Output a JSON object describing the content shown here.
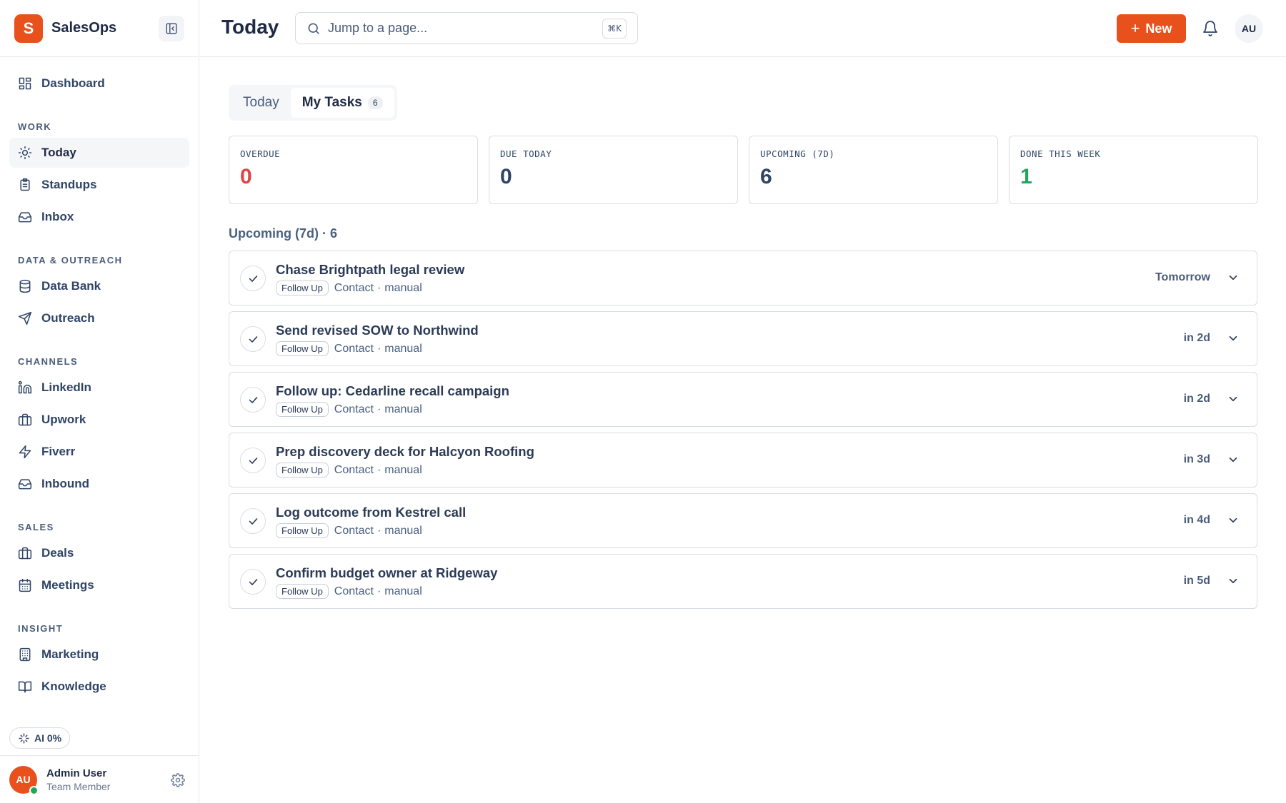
{
  "brand": {
    "name": "SalesOps",
    "logo_letter": "S",
    "color": "#e8501c"
  },
  "sidebar": {
    "top_items": [
      {
        "label": "Dashboard",
        "icon": "grid-icon"
      }
    ],
    "sections": [
      {
        "title": "WORK",
        "items": [
          {
            "label": "Today",
            "icon": "sun-icon",
            "active": true
          },
          {
            "label": "Standups",
            "icon": "clipboard-icon"
          },
          {
            "label": "Inbox",
            "icon": "inbox-icon"
          }
        ]
      },
      {
        "title": "DATA & OUTREACH",
        "items": [
          {
            "label": "Data Bank",
            "icon": "database-icon"
          },
          {
            "label": "Outreach",
            "icon": "send-icon"
          }
        ]
      },
      {
        "title": "CHANNELS",
        "items": [
          {
            "label": "LinkedIn",
            "icon": "linkedin-icon"
          },
          {
            "label": "Upwork",
            "icon": "briefcase-icon"
          },
          {
            "label": "Fiverr",
            "icon": "bolt-icon"
          },
          {
            "label": "Inbound",
            "icon": "inbox-icon"
          }
        ]
      },
      {
        "title": "SALES",
        "items": [
          {
            "label": "Deals",
            "icon": "briefcase-icon"
          },
          {
            "label": "Meetings",
            "icon": "calendar-icon"
          }
        ]
      },
      {
        "title": "INSIGHT",
        "items": [
          {
            "label": "Marketing",
            "icon": "building-icon"
          },
          {
            "label": "Knowledge",
            "icon": "book-icon"
          }
        ]
      }
    ],
    "ai_badge": "AI 0%",
    "user": {
      "initials": "AU",
      "name": "Admin User",
      "role": "Team Member"
    }
  },
  "header": {
    "title": "Today",
    "search_placeholder": "Jump to a page...",
    "search_shortcut": "⌘K",
    "new_label": "New",
    "avatar_initials": "AU"
  },
  "tabs": [
    {
      "label": "Today",
      "active": false
    },
    {
      "label": "My Tasks",
      "active": true,
      "count": "6"
    }
  ],
  "stats": [
    {
      "label": "OVERDUE",
      "value": "0",
      "color": "#e04444"
    },
    {
      "label": "DUE TODAY",
      "value": "0",
      "color": "#2f4466"
    },
    {
      "label": "UPCOMING (7D)",
      "value": "6",
      "color": "#2f4466"
    },
    {
      "label": "DONE THIS WEEK",
      "value": "1",
      "color": "#22a55b"
    }
  ],
  "list_heading": "Upcoming (7d) · 6",
  "tasks": [
    {
      "title": "Chase Brightpath legal review",
      "tag": "Follow Up",
      "entity": "Contact",
      "source": "manual",
      "due": "Tomorrow"
    },
    {
      "title": "Send revised SOW to Northwind",
      "tag": "Follow Up",
      "entity": "Contact",
      "source": "manual",
      "due": "in 2d"
    },
    {
      "title": "Follow up: Cedarline recall campaign",
      "tag": "Follow Up",
      "entity": "Contact",
      "source": "manual",
      "due": "in 2d"
    },
    {
      "title": "Prep discovery deck for Halcyon Roofing",
      "tag": "Follow Up",
      "entity": "Contact",
      "source": "manual",
      "due": "in 3d"
    },
    {
      "title": "Log outcome from Kestrel call",
      "tag": "Follow Up",
      "entity": "Contact",
      "source": "manual",
      "due": "in 4d"
    },
    {
      "title": "Confirm budget owner at Ridgeway",
      "tag": "Follow Up",
      "entity": "Contact",
      "source": "manual",
      "due": "in 5d"
    }
  ]
}
